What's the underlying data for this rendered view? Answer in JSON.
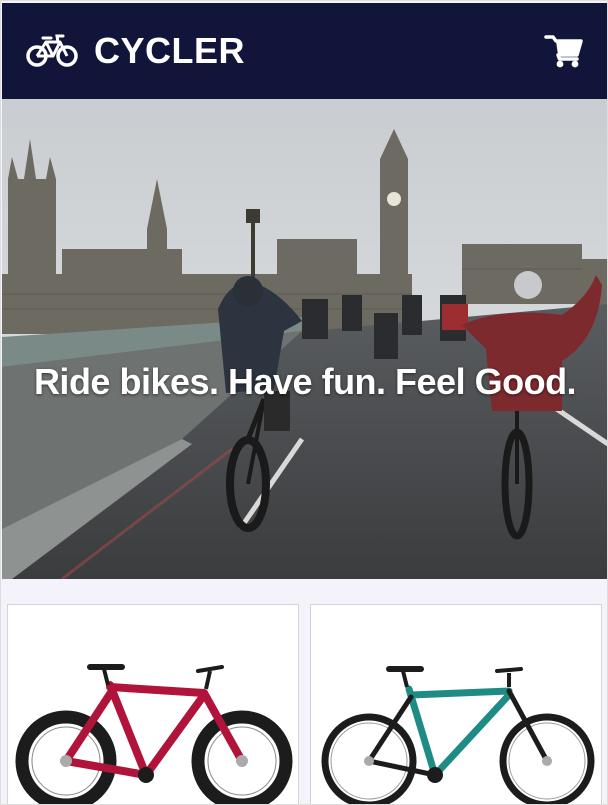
{
  "header": {
    "brand_name": "CYCLER",
    "brand_icon": "bicycle-icon",
    "cart_icon": "shopping-cart-icon",
    "background_color": "#11153a"
  },
  "hero": {
    "tagline": "Ride bikes. Have fun. Feel Good."
  },
  "products": [
    {
      "image": "red-fat-tire-mountain-bike",
      "frame_color": "#b0143a"
    },
    {
      "image": "teal-hardtail-mountain-bike",
      "frame_color": "#1f8b85"
    }
  ]
}
